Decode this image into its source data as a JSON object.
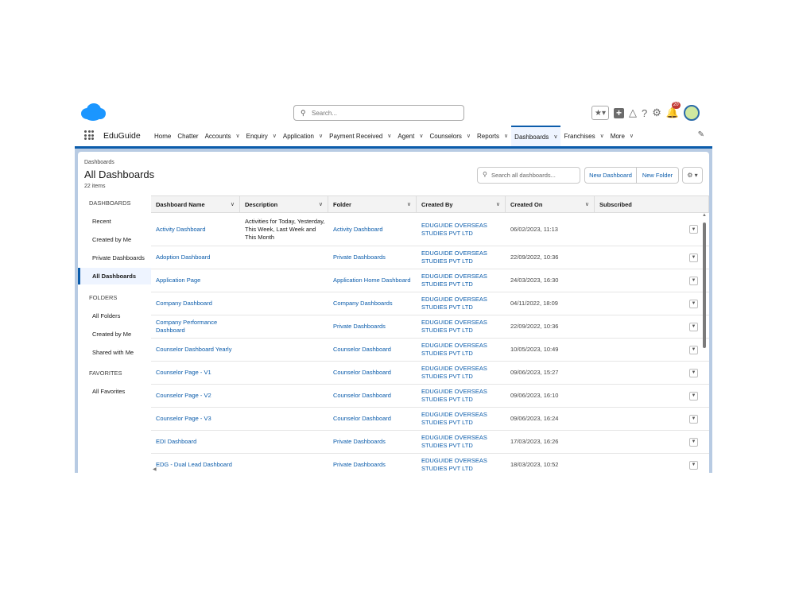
{
  "global_header": {
    "search_placeholder": "Search...",
    "notification_count": "20"
  },
  "nav": {
    "app_name": "EduGuide",
    "tabs": [
      {
        "label": "Home",
        "chevron": false,
        "active": false
      },
      {
        "label": "Chatter",
        "chevron": false,
        "active": false
      },
      {
        "label": "Accounts",
        "chevron": true,
        "active": false
      },
      {
        "label": "Enquiry",
        "chevron": true,
        "active": false
      },
      {
        "label": "Application",
        "chevron": true,
        "active": false
      },
      {
        "label": "Payment Received",
        "chevron": true,
        "active": false
      },
      {
        "label": "Agent",
        "chevron": true,
        "active": false
      },
      {
        "label": "Counselors",
        "chevron": true,
        "active": false
      },
      {
        "label": "Reports",
        "chevron": true,
        "active": false
      },
      {
        "label": "Dashboards",
        "chevron": true,
        "active": true
      },
      {
        "label": "Franchises",
        "chevron": true,
        "active": false
      },
      {
        "label": "More",
        "chevron": true,
        "active": false
      }
    ]
  },
  "page": {
    "breadcrumb": "Dashboards",
    "title": "All Dashboards",
    "item_count": "22 items",
    "search_placeholder": "Search all dashboards...",
    "new_dashboard_label": "New Dashboard",
    "new_folder_label": "New Folder"
  },
  "left_nav": {
    "dashboards_heading": "DASHBOARDS",
    "dashboards_items": [
      "Recent",
      "Created by Me",
      "Private Dashboards",
      "All Dashboards"
    ],
    "folders_heading": "FOLDERS",
    "folders_items": [
      "All Folders",
      "Created by Me",
      "Shared with Me"
    ],
    "favorites_heading": "FAVORITES",
    "favorites_items": [
      "All Favorites"
    ]
  },
  "table": {
    "columns": [
      "Dashboard Name",
      "Description",
      "Folder",
      "Created By",
      "Created On",
      "Subscribed"
    ],
    "rows": [
      {
        "name": "Activity Dashboard",
        "description": "Activities for Today, Yesterday, This Week, Last Week and This Month",
        "folder": "Activity Dashboard",
        "created_by": "EDUGUIDE OVERSEAS STUDIES PVT LTD",
        "created_on": "06/02/2023, 11:13"
      },
      {
        "name": "Adoption Dashboard",
        "description": "",
        "folder": "Private Dashboards",
        "created_by": "EDUGUIDE OVERSEAS STUDIES PVT LTD",
        "created_on": "22/09/2022, 10:36"
      },
      {
        "name": "Application Page",
        "description": "",
        "folder": "Application Home Dashboard",
        "created_by": "EDUGUIDE OVERSEAS STUDIES PVT LTD",
        "created_on": "24/03/2023, 16:30"
      },
      {
        "name": "Company Dashboard",
        "description": "",
        "folder": "Company Dashboards",
        "created_by": "EDUGUIDE OVERSEAS STUDIES PVT LTD",
        "created_on": "04/11/2022, 18:09"
      },
      {
        "name": "Company Performance Dashboard",
        "description": "",
        "folder": "Private Dashboards",
        "created_by": "EDUGUIDE OVERSEAS STUDIES PVT LTD",
        "created_on": "22/09/2022, 10:36"
      },
      {
        "name": "Counselor Dashboard Yearly",
        "description": "",
        "folder": "Counselor Dashboard",
        "created_by": "EDUGUIDE OVERSEAS STUDIES PVT LTD",
        "created_on": "10/05/2023, 10:49"
      },
      {
        "name": "Counselor Page - V1",
        "description": "",
        "folder": "Counselor Dashboard",
        "created_by": "EDUGUIDE OVERSEAS STUDIES PVT LTD",
        "created_on": "09/06/2023, 15:27"
      },
      {
        "name": "Counselor Page - V2",
        "description": "",
        "folder": "Counselor Dashboard",
        "created_by": "EDUGUIDE OVERSEAS STUDIES PVT LTD",
        "created_on": "09/06/2023, 16:10"
      },
      {
        "name": "Counselor Page - V3",
        "description": "",
        "folder": "Counselor Dashboard",
        "created_by": "EDUGUIDE OVERSEAS STUDIES PVT LTD",
        "created_on": "09/06/2023, 16:24"
      },
      {
        "name": "EDI Dashboard",
        "description": "",
        "folder": "Private Dashboards",
        "created_by": "EDUGUIDE OVERSEAS STUDIES PVT LTD",
        "created_on": "17/03/2023, 16:26"
      },
      {
        "name": "EDG - Dual Lead Dashboard",
        "description": "",
        "folder": "Private Dashboards",
        "created_by": "EDUGUIDE OVERSEAS STUDIES PVT LTD",
        "created_on": "18/03/2023, 10:52"
      }
    ]
  },
  "colors": {
    "brand_blue": "#0b5cab",
    "band": "#b8cbe3",
    "cloud": "#1b96ff"
  }
}
